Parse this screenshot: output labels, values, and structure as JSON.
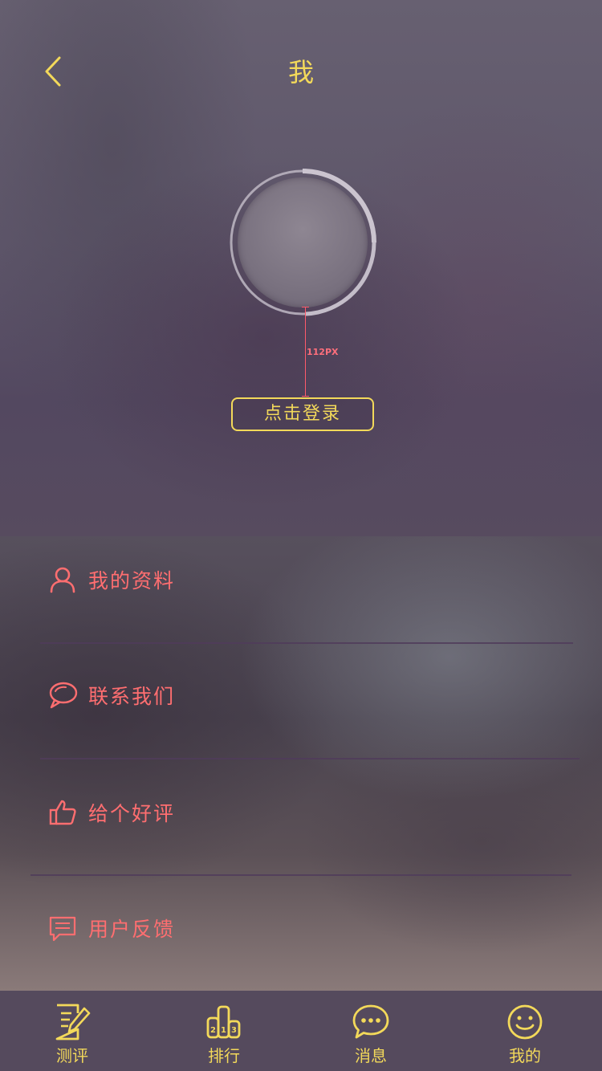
{
  "header": {
    "title": "我"
  },
  "profile": {
    "login_label": "点击登录",
    "spacing_annotation": "112PX"
  },
  "menu": {
    "items": [
      {
        "label": "我的资料",
        "icon": "user-icon"
      },
      {
        "label": "联系我们",
        "icon": "chat-bubble-icon"
      },
      {
        "label": "给个好评",
        "icon": "thumbs-up-icon"
      },
      {
        "label": "用户反馈",
        "icon": "feedback-icon"
      }
    ]
  },
  "tabbar": {
    "items": [
      {
        "label": "测评",
        "icon": "review-edit-icon"
      },
      {
        "label": "排行",
        "icon": "ranking-podium-icon"
      },
      {
        "label": "消息",
        "icon": "message-icon"
      },
      {
        "label": "我的",
        "icon": "smiley-icon"
      }
    ]
  },
  "colors": {
    "accent": "#f3d95a",
    "menu_text": "#ff6e70",
    "annotation": "#ff5a6a"
  }
}
